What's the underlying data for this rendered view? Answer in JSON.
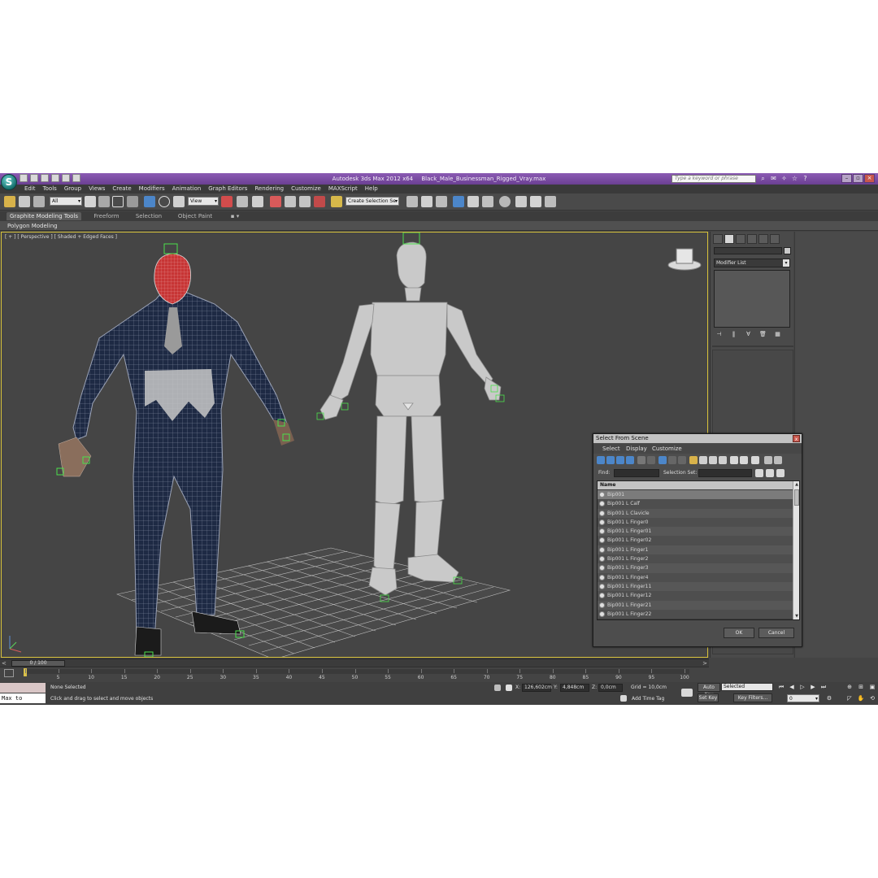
{
  "title_bar": {
    "app_name": "Autodesk 3ds Max  2012 x64",
    "file_name": "Black_Male_Businessman_Rigged_Vray.max",
    "search_placeholder": "Type a keyword or phrase"
  },
  "menu": [
    "Edit",
    "Tools",
    "Group",
    "Views",
    "Create",
    "Modifiers",
    "Animation",
    "Graph Editors",
    "Rendering",
    "Customize",
    "MAXScript",
    "Help"
  ],
  "main_toolbar": {
    "selection_filter": "All",
    "reference_coord": "View",
    "named_selection": "Create Selection Se"
  },
  "ribbon": {
    "tabs": [
      "Graphite Modeling Tools",
      "Freeform",
      "Selection",
      "Object Paint"
    ],
    "panel_label": "Polygon Modeling"
  },
  "viewport": {
    "label": "[ + ] [ Perspective ] [ Shaded + Edged Faces ]"
  },
  "command_panel": {
    "modifier_list": "Modifier List"
  },
  "time_slider": {
    "frame_display": "0 / 100",
    "left_arrow": "<",
    "right_arrow": ">"
  },
  "track_bar": {
    "ticks": [
      "0",
      "5",
      "10",
      "15",
      "20",
      "25",
      "30",
      "35",
      "40",
      "45",
      "50",
      "55",
      "60",
      "65",
      "70",
      "75",
      "80",
      "85",
      "90",
      "95",
      "100"
    ]
  },
  "status": {
    "maxscript_listener": "Max to Physc.",
    "selection_status": "None Selected",
    "prompt": "Click and drag to select and move objects",
    "x_label": "X:",
    "x_value": "126,602cm",
    "y_label": "Y:",
    "y_value": "4,848cm",
    "z_label": "Z:",
    "z_value": "0,0cm",
    "grid": "Grid = 10,0cm",
    "add_time_tag": "Add Time Tag",
    "auto_key": "Auto Key",
    "set_key": "Set Key",
    "key_mode": "Selected",
    "key_filters": "Key Filters...",
    "current_frame": "0"
  },
  "select_dialog": {
    "title": "Select From Scene",
    "close": "x",
    "menu": [
      "Select",
      "Display",
      "Customize"
    ],
    "find_label": "Find:",
    "selection_set_label": "Selection Set:",
    "column_header": "Name",
    "rows": [
      "Bip001",
      "Bip001 L Calf",
      "Bip001 L Clavicle",
      "Bip001 L Finger0",
      "Bip001 L Finger01",
      "Bip001 L Finger02",
      "Bip001 L Finger1",
      "Bip001 L Finger2",
      "Bip001 L Finger3",
      "Bip001 L Finger4",
      "Bip001 L Finger11",
      "Bip001 L Finger12",
      "Bip001 L Finger21",
      "Bip001 L Finger22"
    ],
    "ok": "OK",
    "cancel": "Cancel"
  }
}
